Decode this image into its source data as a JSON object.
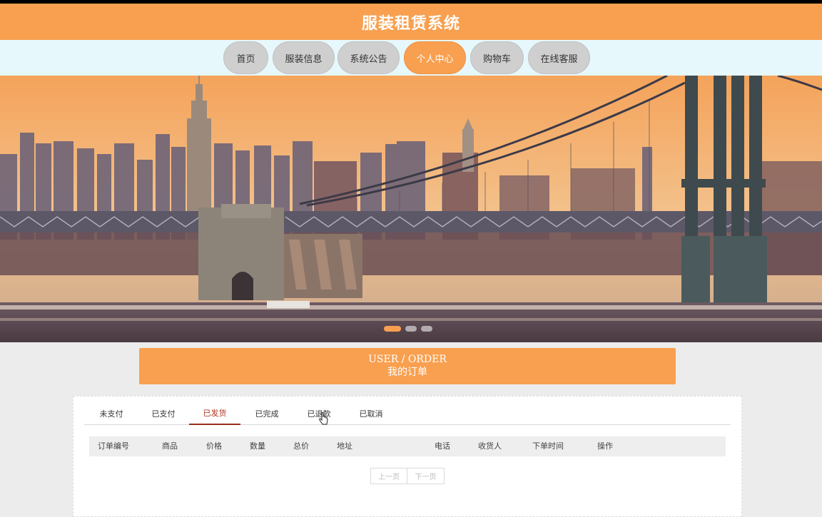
{
  "header": {
    "title": "服装租赁系统"
  },
  "nav": {
    "items": [
      {
        "label": "首页"
      },
      {
        "label": "服装信息"
      },
      {
        "label": "系统公告"
      },
      {
        "label": "个人中心"
      },
      {
        "label": "购物车"
      },
      {
        "label": "在线客服"
      }
    ],
    "active": "个人中心"
  },
  "banner": {
    "slide_count": 3,
    "active_slide": 1
  },
  "order": {
    "title_en": "USER / ORDER",
    "title_cn": "我的订单",
    "tabs": [
      {
        "label": "未支付"
      },
      {
        "label": "已支付"
      },
      {
        "label": "已发货"
      },
      {
        "label": "已完成"
      },
      {
        "label": "已退款"
      },
      {
        "label": "已取消"
      }
    ],
    "active_tab": "已发货",
    "columns": [
      "订单编号",
      "商品",
      "价格",
      "数量",
      "总价",
      "地址",
      "电话",
      "收货人",
      "下单时间",
      "操作"
    ],
    "rows": [],
    "pager": {
      "prev": "上一页",
      "next": "下一页"
    }
  },
  "colors": {
    "accent": "#f8a050",
    "nav_bg": "#e6f8fb",
    "page_bg": "#ececec",
    "active_tab": "#9a2d1a"
  }
}
